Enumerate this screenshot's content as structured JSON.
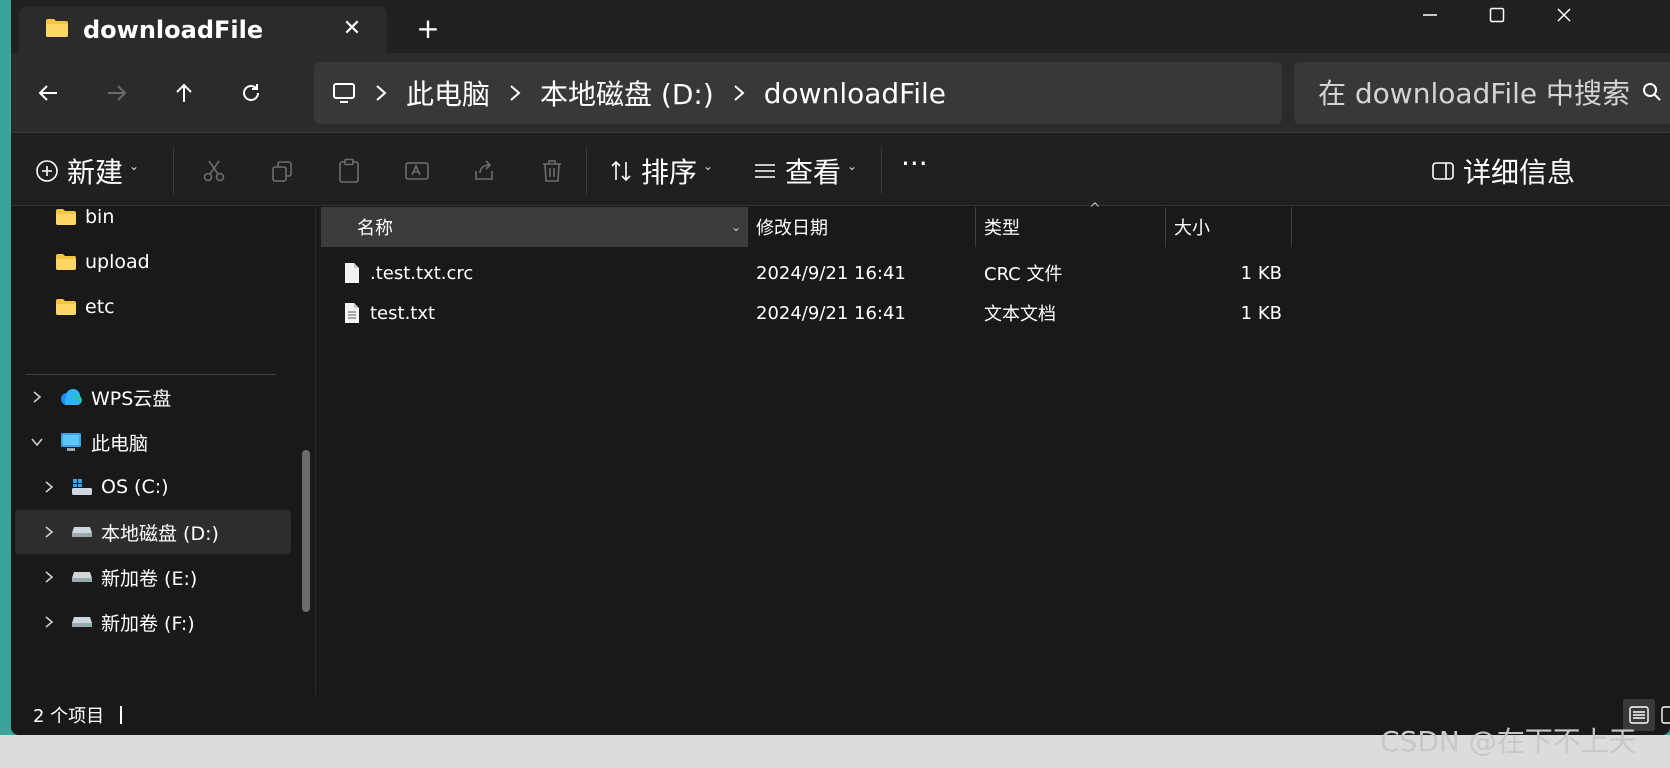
{
  "window": {
    "tab_title": "downloadFile",
    "new_tab_label": "+",
    "close_label": "✕"
  },
  "address": {
    "crumbs": [
      "此电脑",
      "本地磁盘 (D:)",
      "downloadFile"
    ],
    "search_placeholder": "在 downloadFile 中搜索"
  },
  "toolbar": {
    "new_label": "新建",
    "sort_label": "排序",
    "view_label": "查看",
    "more_label": "···",
    "details_label": "详细信息"
  },
  "sidebar": {
    "folders": [
      {
        "label": "bin"
      },
      {
        "label": "upload"
      },
      {
        "label": "etc"
      }
    ],
    "wps": "WPS云盘",
    "this_pc": "此电脑",
    "drives": [
      {
        "label": "OS (C:)"
      },
      {
        "label": "本地磁盘 (D:)",
        "selected": true
      },
      {
        "label": "新加卷 (E:)"
      },
      {
        "label": "新加卷 (F:)"
      }
    ]
  },
  "filelist": {
    "columns": [
      "名称",
      "修改日期",
      "类型",
      "大小"
    ],
    "rows": [
      {
        "name": ".test.txt.crc",
        "date": "2024/9/21 16:41",
        "type": "CRC 文件",
        "size": "1 KB"
      },
      {
        "name": "test.txt",
        "date": "2024/9/21 16:41",
        "type": "文本文档",
        "size": "1 KB"
      }
    ]
  },
  "status": {
    "count": "2 个项目"
  },
  "watermark": "CSDN @在下不上天",
  "colors": {
    "window_bg": "#191919",
    "toolbar_bg": "#202020",
    "accent_folder": "#f6c342",
    "selected_bg": "#2d2d2d"
  }
}
